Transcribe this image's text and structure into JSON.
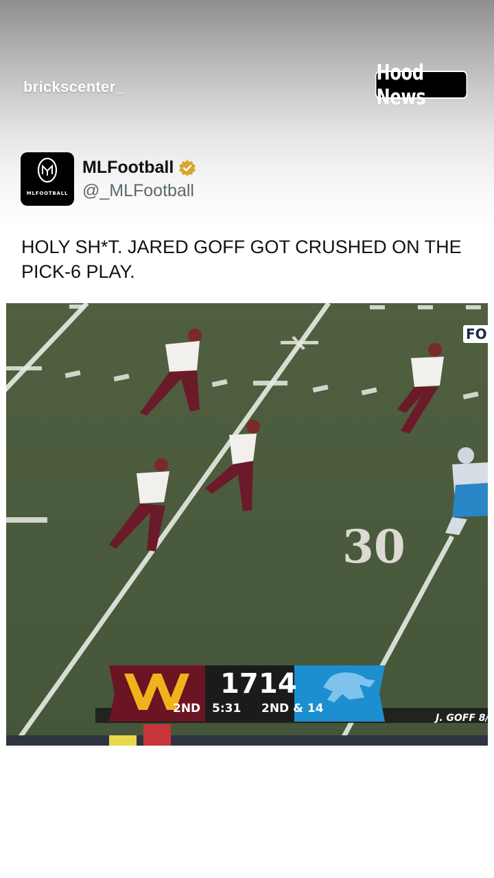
{
  "overlay": {
    "username": "brickscenter_",
    "badge": "Hood News"
  },
  "post": {
    "avatar_label": "MLFOOTBALL",
    "display_name": "MLFootball",
    "handle": "@_MLFootball",
    "verified_icon": "gold-verified-badge-icon",
    "text": "HOLY SH*T. JARED GOFF GOT CRUSHED ON THE PICK-6 PLAY."
  },
  "video": {
    "network": "FO",
    "field_number": "30",
    "scorebug": {
      "home_score": "17",
      "away_score": "14",
      "quarter": "2ND",
      "clock": "5:31",
      "down_distance": "2ND & 14",
      "player_caption": "J. GOFF 8/"
    },
    "colors": {
      "home_team": "#6b1424",
      "home_accent": "#f2b21c",
      "away_team": "#1b8fcf",
      "field": "#4d5e3e"
    }
  }
}
